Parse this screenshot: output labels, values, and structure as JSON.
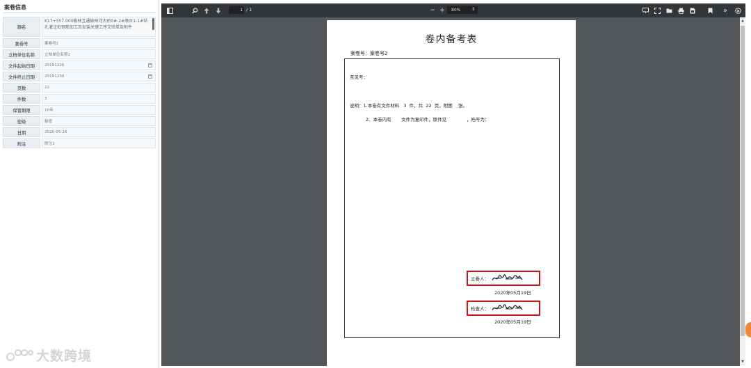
{
  "panel": {
    "title": "案卷信息",
    "fields": [
      {
        "label": "题名",
        "value": "K17+357.000榆林互通榆林河大桥0#-2#墩台1-1#钻孔灌注桩钢筋加工及安装关键工序文验单及附件"
      },
      {
        "label": "案卷号",
        "value": "案卷号2"
      },
      {
        "label": "立档单位名称",
        "value": "立档单位名称2"
      },
      {
        "label": "文件起始日期",
        "value": "20191226"
      },
      {
        "label": "文件终止日期",
        "value": "20191230"
      },
      {
        "label": "页数",
        "value": "22"
      },
      {
        "label": "件数",
        "value": "3"
      },
      {
        "label": "保管期限",
        "value": "10年"
      },
      {
        "label": "密级",
        "value": "秘密"
      },
      {
        "label": "日期",
        "value": "2020-05-16"
      },
      {
        "label": "附注",
        "value": "附注2"
      }
    ]
  },
  "watermark": {
    "text": "大数跨境"
  },
  "viewer": {
    "toolbar": {
      "page_current": "1",
      "page_total": "/ 1",
      "zoom_minus": "−",
      "zoom_plus": "+",
      "zoom": "80%"
    },
    "colors": {
      "toolbar_bg": "#323639",
      "canvas_bg": "#525659",
      "highlight": "#c8161d"
    }
  },
  "doc": {
    "title": "卷内备考表",
    "archive_line": "案卷号：案卷号2",
    "ref_line": "互见号：",
    "note1": "说明：1.本卷有文件材料   3  件，共  22  页，附图    张。",
    "note2": "2、本卷内有       文件为复印件，原件见              ，档号为：",
    "preparer_label": "立卷人：",
    "preparer_date": "2020年05月19日",
    "checker_label": "检查人：",
    "checker_date": "2020年05月19日"
  }
}
